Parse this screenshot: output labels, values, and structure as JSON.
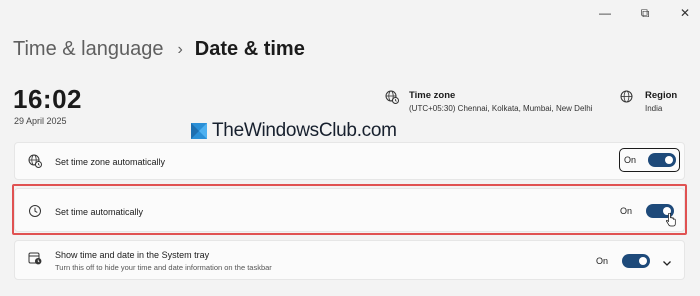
{
  "window": {
    "minimize_glyph": "—",
    "maximize_glyph": "⧉",
    "close_glyph": "✕"
  },
  "breadcrumb": {
    "parent": "Time & language",
    "separator": "›",
    "current": "Date & time"
  },
  "clock": {
    "time": "16:02",
    "date": "29 April 2025"
  },
  "time_zone": {
    "title": "Time zone",
    "value": "(UTC+05:30) Chennai, Kolkata, Mumbai, New Delhi",
    "icon": "globe-clock-icon"
  },
  "region": {
    "title": "Region",
    "value": "India",
    "icon": "globe-icon"
  },
  "watermark": {
    "text": "TheWindowsClub.com"
  },
  "settings": [
    {
      "label": "Set time zone automatically",
      "icon": "globe-clock-icon",
      "state": "On",
      "on": true
    },
    {
      "label": "Set time automatically",
      "icon": "clock-icon",
      "state": "On",
      "on": true
    },
    {
      "label": "Show time and date in the System tray",
      "sublabel": "Turn this off to hide your time and date information on the taskbar",
      "icon": "calendar-clock-icon",
      "state": "On",
      "on": true
    }
  ],
  "colors": {
    "accent": "#1e4a7a",
    "highlight": "#e05252",
    "background": "#f3f3f3"
  }
}
